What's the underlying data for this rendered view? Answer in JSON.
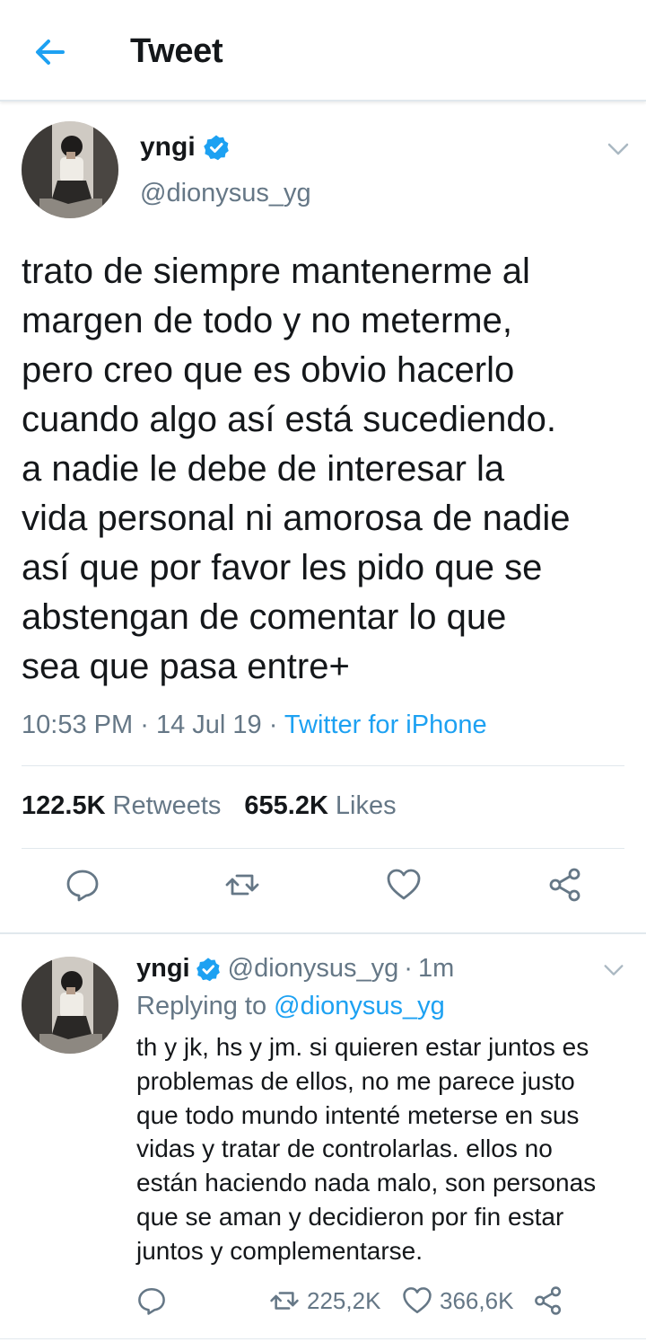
{
  "header": {
    "title": "Tweet",
    "back_icon": "arrow-left-icon"
  },
  "colors": {
    "accent": "#1da1f2",
    "text": "#14171a",
    "secondary": "#657786",
    "divider": "#e1e8ed"
  },
  "main_tweet": {
    "display_name": "yngi",
    "handle": "@dionysus_yg",
    "text": "trato de siempre mantenerme al\nmargen de todo y no meterme,\npero creo que es obvio hacerlo\ncuando algo así está sucediendo.\na nadie le debe de interesar la\nvida personal ni amorosa de nadie\nasí que por favor les pido que se\nabstengan de comentar lo que\nsea que pasa entre+",
    "time": "10:53 PM",
    "dot1": "·",
    "date": "14 Jul 19",
    "dot2": "·",
    "source": "Twitter for iPhone",
    "retweets_count": "122.5K",
    "retweets_label": "Retweets",
    "likes_count": "655.2K",
    "likes_label": "Likes"
  },
  "reply_tweet": {
    "display_name": "yngi",
    "handle": "@dionysus_yg",
    "separator": "·",
    "age": "1m",
    "replying_prefix": "Replying to",
    "replying_to": "@dionysus_yg",
    "text": "th y jk, hs y jm. si quieren estar juntos es\nproblemas de ellos, no me parece justo\nque todo mundo intenté meterse en sus\nvidas y tratar de controlarlas. ellos no\nestán haciendo nada malo, son personas\nque se aman y decidieron por fin estar\njuntos y complementarse.",
    "retweets": "225,2K",
    "likes": "366,6K"
  }
}
